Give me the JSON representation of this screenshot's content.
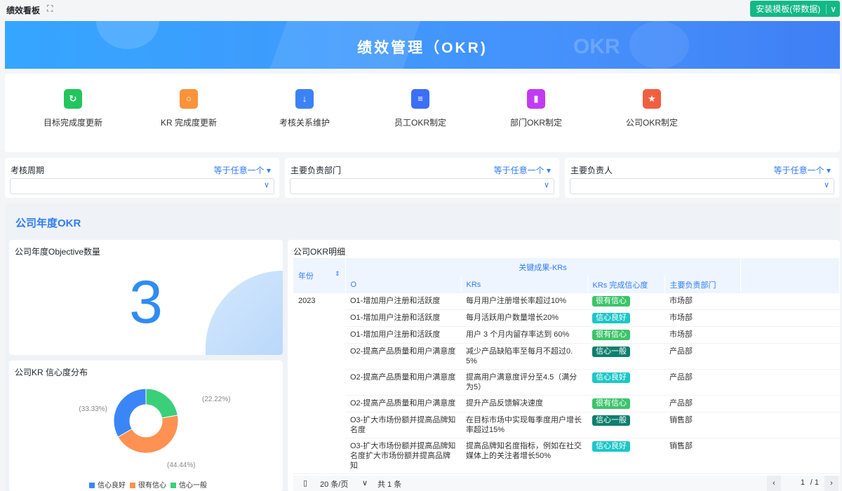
{
  "topbar": {
    "title": "绩效看板",
    "install_label": "安装模板(带数据)"
  },
  "banner": {
    "title": "绩效管理（OKR)",
    "watermark": "OKR"
  },
  "shortcuts": [
    {
      "label": "目标完成度更新",
      "icon": "ribbon-icon",
      "color": "#22c55e",
      "glyph": "↻"
    },
    {
      "label": "KR 完成度更新",
      "icon": "box-icon",
      "color": "#fb923c",
      "glyph": "○"
    },
    {
      "label": "考核关系维护",
      "icon": "user-download-icon",
      "color": "#3b82f6",
      "glyph": "↓"
    },
    {
      "label": "员工OKR制定",
      "icon": "document-icon",
      "color": "#3b6ff5",
      "glyph": "≡"
    },
    {
      "label": "部门OKR制定",
      "icon": "chart-icon",
      "color": "#c13cf0",
      "glyph": "▮"
    },
    {
      "label": "公司OKR制定",
      "icon": "flag-icon",
      "color": "#f06040",
      "glyph": "★"
    }
  ],
  "filters": [
    {
      "label": "考核周期",
      "operator": "等于任意一个"
    },
    {
      "label": "主要负责部门",
      "operator": "等于任意一个"
    },
    {
      "label": "主要负责人",
      "operator": "等于任意一个"
    }
  ],
  "section_title": "公司年度OKR",
  "objective_count": {
    "title": "公司年度Objective数量",
    "value": "3"
  },
  "chart_data": {
    "type": "pie",
    "title": "公司KR 信心度分布",
    "series": [
      {
        "name": "信心一般",
        "value": 22.22,
        "label": "(22.22%)",
        "color": "#3ccf7a"
      },
      {
        "name": "很有信心",
        "value": 44.44,
        "label": "(44.44%)",
        "color": "#ff9152"
      },
      {
        "name": "信心良好",
        "value": 33.33,
        "label": "(33.33%)",
        "color": "#3b86f7"
      }
    ],
    "legend": [
      "信心良好",
      "很有信心",
      "信心一般"
    ],
    "legend_colors": [
      "#3b86f7",
      "#ff9152",
      "#3ccf7a"
    ]
  },
  "table": {
    "title": "公司OKR明细",
    "group_header": "关键成果-KRs",
    "headers": [
      "年份",
      "O",
      "KRs",
      "KRs 完成信心度",
      "主要负责部门"
    ],
    "year": "2023",
    "rows": [
      {
        "o": "O1-增加用户注册和活跃度",
        "kr": "每月用户注册增长率超过10%",
        "conf": "很有信心",
        "dept": "市场部"
      },
      {
        "o": "O1-增加用户注册和活跃度",
        "kr": "每月活跃用户数量增长20%",
        "conf": "信心良好",
        "dept": "市场部"
      },
      {
        "o": "O1-增加用户注册和活跃度",
        "kr": "用户 3 个月内留存率达到 60%",
        "conf": "很有信心",
        "dept": "市场部"
      },
      {
        "o": "O2-提高产品质量和用户满意度",
        "kr": "减少产品缺陷率至每月不超过0.5%",
        "conf": "信心一般",
        "dept": "产品部"
      },
      {
        "o": "O2-提高产品质量和用户满意度",
        "kr": "提高用户满意度评分至4.5（满分为5）",
        "conf": "信心良好",
        "dept": "产品部"
      },
      {
        "o": "O2-提高产品质量和用户满意度",
        "kr": "提升产品反馈解决速度",
        "conf": "很有信心",
        "dept": "产品部"
      },
      {
        "o": "O3-扩大市场份额并提高品牌知名度",
        "kr": "在目标市场中实现每季度用户增长率超过15%",
        "conf": "信心一般",
        "dept": "销售部"
      },
      {
        "o": "O3-扩大市场份额并提高品牌知名度扩大市场份额并提高品牌知",
        "kr": "提高品牌知名度指标，例如在社交媒体上的关注者增长50%",
        "conf": "信心良好",
        "dept": "销售部"
      }
    ],
    "conf_colors": {
      "很有信心": "#3cc46a",
      "信心良好": "#1cc7c7",
      "信心一般": "#0d7f6e"
    },
    "pager": {
      "page_size": "20 条/页",
      "total": "共 1 条",
      "page": "1",
      "pages": "/ 1"
    }
  }
}
